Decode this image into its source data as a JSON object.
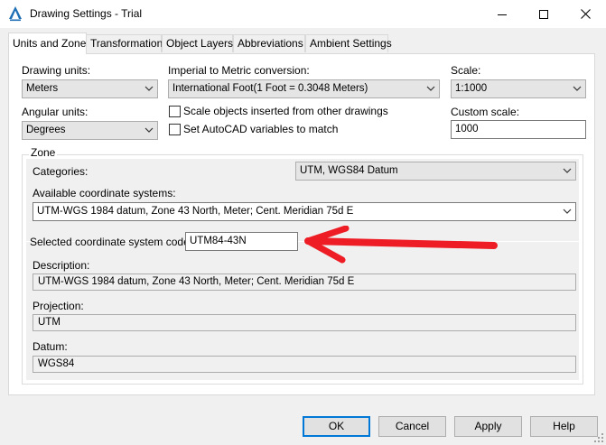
{
  "window": {
    "title": "Drawing Settings - Trial",
    "controls": {
      "minimize": "minimize",
      "maximize": "maximize",
      "close": "close"
    }
  },
  "tabs": [
    {
      "label": "Units and Zone",
      "active": true
    },
    {
      "label": "Transformation",
      "active": false
    },
    {
      "label": "Object Layers",
      "active": false
    },
    {
      "label": "Abbreviations",
      "active": false
    },
    {
      "label": "Ambient Settings",
      "active": false
    }
  ],
  "units": {
    "drawing_units_label": "Drawing units:",
    "drawing_units_value": "Meters",
    "conversion_label": "Imperial to Metric conversion:",
    "conversion_value": "International Foot(1 Foot = 0.3048 Meters)",
    "scale_label": "Scale:",
    "scale_value": "1:1000",
    "angular_units_label": "Angular units:",
    "angular_units_value": "Degrees",
    "scale_objects_label": "Scale objects inserted from other drawings",
    "scale_objects_checked": false,
    "set_autocad_label": "Set AutoCAD variables to match",
    "set_autocad_checked": false,
    "custom_scale_label": "Custom scale:",
    "custom_scale_value": "1000"
  },
  "zone": {
    "group_label": "Zone",
    "categories_label": "Categories:",
    "categories_value": "UTM, WGS84 Datum",
    "available_label": "Available coordinate systems:",
    "available_value": "UTM-WGS 1984 datum, Zone 43 North, Meter; Cent. Meridian 75d E",
    "selected_code_label": "Selected coordinate system code:",
    "selected_code_value": "UTM84-43N",
    "description_label": "Description:",
    "description_value": "UTM-WGS 1984 datum, Zone 43 North, Meter; Cent. Meridian 75d E",
    "projection_label": "Projection:",
    "projection_value": "UTM",
    "datum_label": "Datum:",
    "datum_value": "WGS84"
  },
  "buttons": {
    "ok": "OK",
    "cancel": "Cancel",
    "apply": "Apply",
    "help": "Help"
  },
  "colors": {
    "annotation_arrow": "#ee1c24",
    "focus_border": "#0078d7"
  }
}
